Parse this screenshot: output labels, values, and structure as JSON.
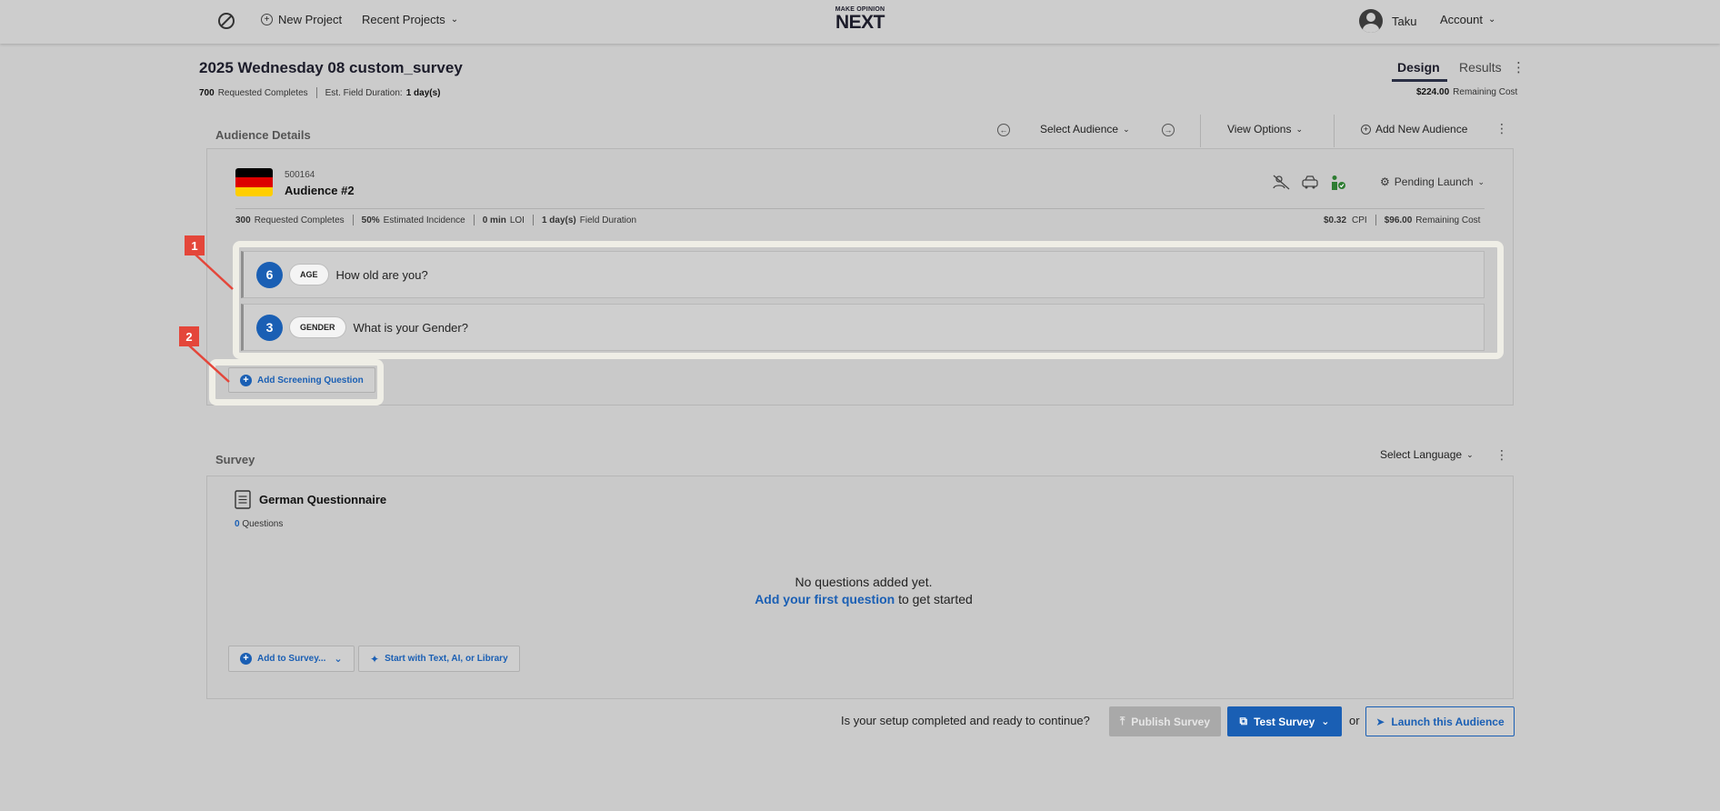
{
  "nav": {
    "new_project": "New Project",
    "recent_projects": "Recent Projects",
    "logo_top": "MAKE OPINION",
    "logo_main": "NEXT",
    "user_name": "Taku",
    "account": "Account"
  },
  "project": {
    "title": "2025 Wednesday 08 custom_survey",
    "requested_count": "700",
    "requested_label": "Requested Completes",
    "duration_label": "Est. Field Duration:",
    "duration_value": "1 day(s)",
    "tabs": {
      "design": "Design",
      "results": "Results"
    },
    "remaining_cost_value": "$224.00",
    "remaining_cost_label": "Remaining Cost"
  },
  "audience_details": {
    "section_title": "Audience Details",
    "select_audience": "Select Audience",
    "view_options": "View Options",
    "add_new_audience": "Add New Audience",
    "audience": {
      "id": "500164",
      "name": "Audience #2",
      "status": "Pending Launch",
      "requested_count": "300",
      "requested_label": "Requested Completes",
      "incidence_value": "50%",
      "incidence_label": "Estimated Incidence",
      "loi_value": "0 min",
      "loi_label": "LOI",
      "duration_value": "1 day(s)",
      "duration_label": "Field Duration",
      "cpi_value": "$0.32",
      "cpi_label": "CPI",
      "remaining_value": "$96.00",
      "remaining_label": "Remaining Cost",
      "flag_colors": [
        "#000000",
        "#dd0000",
        "#ffce00"
      ]
    },
    "questions": [
      {
        "count": "6",
        "tag": "AGE",
        "text": "How old are you?"
      },
      {
        "count": "3",
        "tag": "GENDER",
        "text": "What is your Gender?"
      }
    ],
    "add_screening_question": "Add Screening Question"
  },
  "annotations": {
    "badge1": "1",
    "badge2": "2"
  },
  "survey": {
    "section_title": "Survey",
    "select_language": "Select Language",
    "questionnaire_title": "German Questionnaire",
    "question_count": "0",
    "questions_label": "Questions",
    "empty_title": "No questions added yet.",
    "empty_link": "Add your first question",
    "empty_suffix": " to get started",
    "add_to_survey": "Add to Survey...",
    "start_with": "Start with Text, AI, or Library"
  },
  "footer": {
    "prompt": "Is your setup completed and ready to continue?",
    "publish": "Publish Survey",
    "test": "Test Survey",
    "or": "or",
    "launch": "Launch this Audience"
  },
  "colors": {
    "accent": "#1a5fb4",
    "badge": "#e4463a",
    "highlight": "#efeee6"
  }
}
